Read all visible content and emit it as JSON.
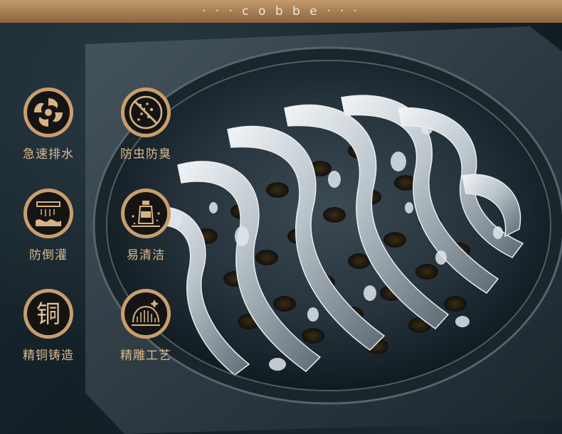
{
  "header": {
    "brand_text": "· · · c o b b e · · ·"
  },
  "features": [
    {
      "label": "急速排水",
      "icon": "swirl-icon"
    },
    {
      "label": "防虫防臭",
      "icon": "no-bugs-icon"
    },
    {
      "label": "防倒灌",
      "icon": "anti-backflow-icon"
    },
    {
      "label": "易清洁",
      "icon": "easy-clean-icon"
    },
    {
      "label": "精铜铸造",
      "icon": "copper-char-icon",
      "glyph": "铜"
    },
    {
      "label": "精雕工艺",
      "icon": "craft-icon"
    }
  ],
  "colors": {
    "accent_gold": "#d9b98c",
    "header_bronze": "#a47c52",
    "background": "#0f1920"
  }
}
